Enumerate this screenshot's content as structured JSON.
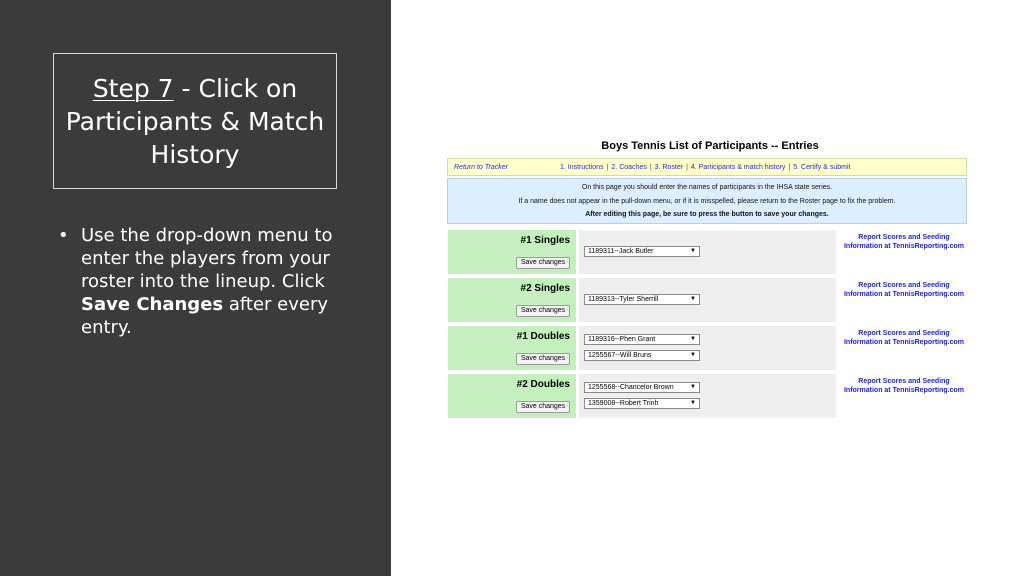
{
  "slide": {
    "title_step": "Step 7",
    "title_rest": " - Click on Participants & Match History",
    "bullet": {
      "part1": "Use the drop-down menu to enter the players from your roster into the lineup.  Click ",
      "bold": "Save Changes",
      "part2": " after every entry."
    },
    "colors": {
      "panel": "#3b3b3b",
      "text": "#ffffff"
    }
  },
  "screenshot": {
    "heading": "Boys Tennis List of Participants -- Entries",
    "nav": {
      "return_link": "Return to Tracker",
      "links": [
        "1. Instructions",
        "2. Coaches",
        "3. Roster",
        "4. Participants & match history",
        "5. Certify & submit"
      ],
      "separator": "|"
    },
    "info": {
      "line1": "On this page you should enter the names of participants in the IHSA state series.",
      "line2": "If a name does not appear in the pull-down menu, or if it is misspelled, please return to the Roster page to fix the problem.",
      "line3": "After editing this page, be sure to press the button to save your changes."
    },
    "save_label": "Save changes",
    "report_text": "Report Scores and Seeding Information at TennisReporting.com",
    "events": [
      {
        "name": "#1 Singles",
        "players": [
          "1189311--Jack Butler"
        ]
      },
      {
        "name": "#2 Singles",
        "players": [
          "1189313--Tyler Sherrill"
        ]
      },
      {
        "name": "#1 Doubles",
        "players": [
          "1189316--Phen Grant",
          "1255567--Will Bruns"
        ]
      },
      {
        "name": "#2 Doubles",
        "players": [
          "1255568--Chancelor Brown",
          "1359008--Robert Trinh"
        ]
      }
    ],
    "colors": {
      "nav_bg": "#ffffcc",
      "info_bg": "#ddeeff",
      "label_bg": "#c6efc0",
      "select_bg": "#efefef",
      "link": "#2222cc"
    }
  }
}
